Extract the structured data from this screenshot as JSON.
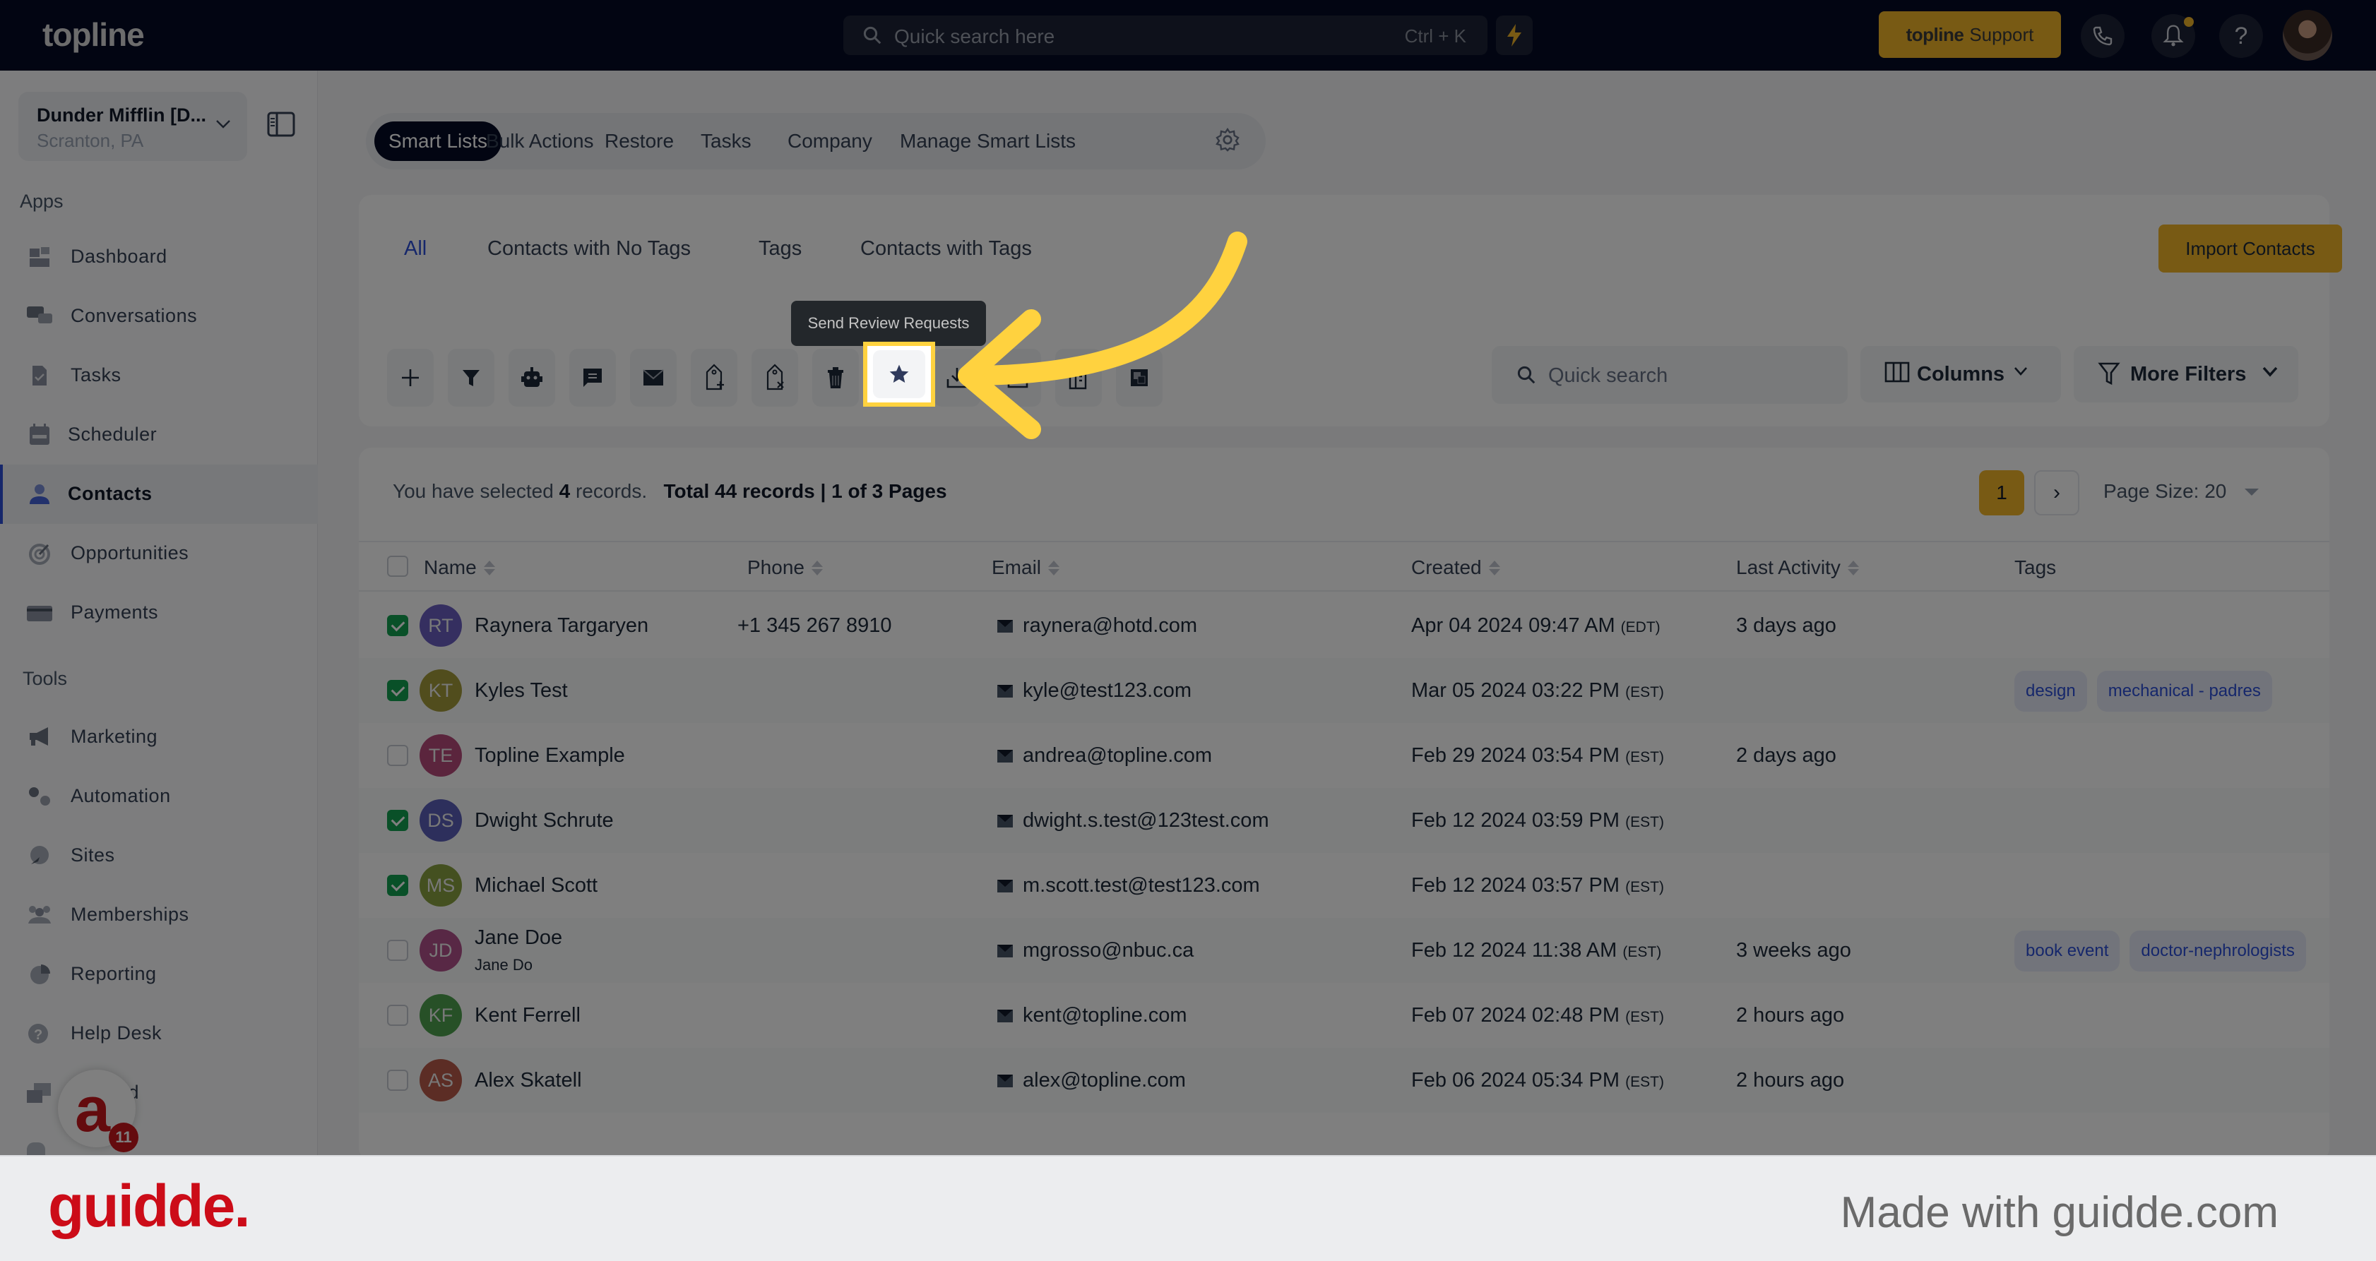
{
  "header": {
    "logo": "topline",
    "search_placeholder": "Quick search here",
    "search_shortcut": "Ctrl + K",
    "support_brand": "topline",
    "support_label": "Support"
  },
  "sidebar": {
    "location_name": "Dunder Mifflin [D...",
    "location_sub": "Scranton, PA",
    "apps_label": "Apps",
    "tools_label": "Tools",
    "apps": [
      {
        "label": "Dashboard",
        "icon": "dashboard-icon"
      },
      {
        "label": "Conversations",
        "icon": "conversations-icon"
      },
      {
        "label": "Tasks",
        "icon": "tasks-icon"
      },
      {
        "label": "Scheduler",
        "icon": "calendar-icon"
      },
      {
        "label": "Contacts",
        "icon": "contacts-icon",
        "active": true
      },
      {
        "label": "Opportunities",
        "icon": "target-icon"
      },
      {
        "label": "Payments",
        "icon": "credit-card-icon"
      }
    ],
    "tools": [
      {
        "label": "Marketing",
        "icon": "megaphone-icon"
      },
      {
        "label": "Automation",
        "icon": "gears-icon"
      },
      {
        "label": "Sites",
        "icon": "globe-icon"
      },
      {
        "label": "Memberships",
        "icon": "members-icon"
      },
      {
        "label": "Reporting",
        "icon": "pie-chart-icon"
      },
      {
        "label": "Help Desk",
        "icon": "help-icon"
      },
      {
        "label": "Mailfold",
        "icon": "mailfold-icon"
      }
    ],
    "chat_badge": "11"
  },
  "top_tabs": [
    "Smart Lists",
    "Bulk Actions",
    "Restore",
    "Tasks",
    "Company",
    "Manage Smart Lists"
  ],
  "smart_tabs": [
    "All",
    "Contacts with No Tags",
    "Tags",
    "Contacts with Tags"
  ],
  "import_button": "Import Contacts",
  "toolbar": {
    "actions": [
      "add-contact",
      "filter",
      "automation-bot",
      "sms",
      "email",
      "add-tag",
      "remove-tag",
      "delete",
      "send-review-requests",
      "export",
      "import",
      "company",
      "merge"
    ],
    "tooltip": "Send Review Requests",
    "search_placeholder": "Quick search",
    "columns_label": "Columns",
    "more_filters_label": "More Filters"
  },
  "summary": {
    "prefix": "You have selected",
    "selected_count": "4",
    "suffix": "records.",
    "total": "Total 44 records",
    "pages": "1 of 3 Pages"
  },
  "pagination": {
    "current_page": "1",
    "next": "›",
    "page_size": "Page Size: 20"
  },
  "table": {
    "columns": [
      "Name",
      "Phone",
      "Email",
      "Created",
      "Last Activity",
      "Tags"
    ],
    "rows": [
      {
        "initials": "RT",
        "avatar_color": "#6a5fc1",
        "name": "Raynera Targaryen",
        "sub": "",
        "phone": "+1 345 267 8910",
        "email": "raynera@hotd.com",
        "created": "Apr 04 2024 09:47 AM",
        "tz": "(EDT)",
        "last_activity": "3 days ago",
        "tags": [],
        "checked": true
      },
      {
        "initials": "KT",
        "avatar_color": "#a29a3a",
        "name": "Kyles Test",
        "sub": "",
        "phone": "",
        "email": "kyle@test123.com",
        "created": "Mar 05 2024 03:22 PM",
        "tz": "(EST)",
        "last_activity": "",
        "tags": [
          "design",
          "mechanical - padres"
        ],
        "checked": true
      },
      {
        "initials": "TE",
        "avatar_color": "#b64a7a",
        "name": "Topline Example",
        "sub": "",
        "phone": "",
        "email": "andrea@topline.com",
        "created": "Feb 29 2024 03:54 PM",
        "tz": "(EST)",
        "last_activity": "2 days ago",
        "tags": [],
        "checked": false
      },
      {
        "initials": "DS",
        "avatar_color": "#5a5fb8",
        "name": "Dwight Schrute",
        "sub": "",
        "phone": "",
        "email": "dwight.s.test@123test.com",
        "created": "Feb 12 2024 03:59 PM",
        "tz": "(EST)",
        "last_activity": "",
        "tags": [],
        "checked": true
      },
      {
        "initials": "MS",
        "avatar_color": "#88a040",
        "name": "Michael Scott",
        "sub": "",
        "phone": "",
        "email": "m.scott.test@test123.com",
        "created": "Feb 12 2024 03:57 PM",
        "tz": "(EST)",
        "last_activity": "",
        "tags": [],
        "checked": true
      },
      {
        "initials": "JD",
        "avatar_color": "#b0508a",
        "name": "Jane Doe",
        "sub": "Jane Do",
        "phone": "",
        "email": "mgrosso@nbuc.ca",
        "created": "Feb 12 2024 11:38 AM",
        "tz": "(EST)",
        "last_activity": "3 weeks ago",
        "tags": [
          "book event",
          "doctor-nephrologists"
        ],
        "checked": false
      },
      {
        "initials": "KF",
        "avatar_color": "#4ea04e",
        "name": "Kent Ferrell",
        "sub": "",
        "phone": "",
        "email": "kent@topline.com",
        "created": "Feb 07 2024 02:48 PM",
        "tz": "(EST)",
        "last_activity": "2 hours ago",
        "tags": [],
        "checked": false
      },
      {
        "initials": "AS",
        "avatar_color": "#b85a4a",
        "name": "Alex Skatell",
        "sub": "",
        "phone": "",
        "email": "alex@topline.com",
        "created": "Feb 06 2024 05:34 PM",
        "tz": "(EST)",
        "last_activity": "2 hours ago",
        "tags": [],
        "checked": false
      }
    ]
  },
  "footer": {
    "brand": "guidde.",
    "made_with": "Made with guidde.com"
  },
  "colors": {
    "accent": "#f0b429",
    "primary": "#2c4fd6",
    "header_bg": "#040b24",
    "highlight": "#ffd23f",
    "guidde_red": "#cc0c18"
  }
}
